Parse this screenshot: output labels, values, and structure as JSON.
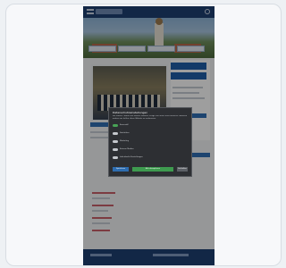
{
  "cookie_dialog": {
    "title": "Datenschutzeinstellungen",
    "description": "Wir nutzen Cookies auf unserer Website. Einige von ihnen sind essenziell, während andere uns helfen, diese Website zu verbessern.",
    "options": [
      {
        "label": "Essenziell",
        "enabled": true
      },
      {
        "label": "Statistiken",
        "enabled": false
      },
      {
        "label": "Marketing",
        "enabled": false
      },
      {
        "label": "Externe Medien",
        "enabled": false
      },
      {
        "label": "Individuelle Einstellungen",
        "enabled": false
      }
    ],
    "buttons": {
      "save": "Speichern",
      "accept_all": "Alle akzeptieren",
      "close": "Schließen"
    }
  },
  "colors": {
    "header": "#1d3f71",
    "accent": "#1f5ea8",
    "accept": "#3e9b4f"
  }
}
